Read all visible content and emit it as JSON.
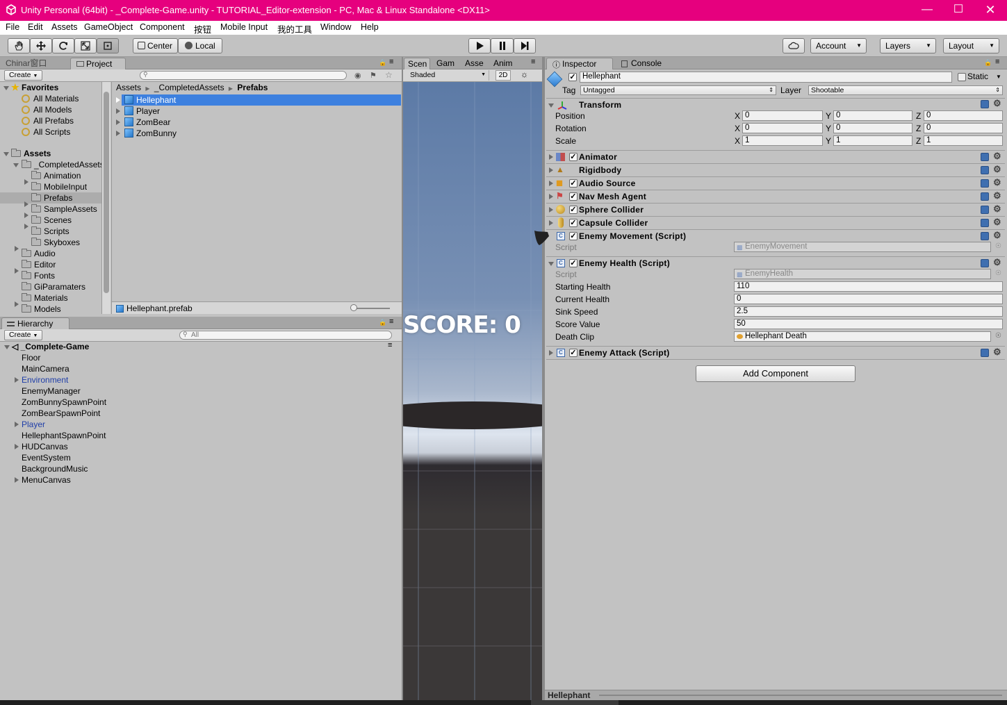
{
  "title_bar": {
    "text": "Unity Personal (64bit) - _Complete-Game.unity - TUTORIAL_Editor-extension - PC, Mac & Linux Standalone <DX11>",
    "controls": [
      "minimize",
      "maximize",
      "close"
    ]
  },
  "menu": [
    "File",
    "Edit",
    "Assets",
    "GameObject",
    "Component",
    "按钮",
    "Mobile Input",
    "我的工具",
    "Window",
    "Help"
  ],
  "toolbar": {
    "pivot": "Center",
    "space": "Local",
    "account": "Account",
    "layers": "Layers",
    "layout": "Layout"
  },
  "project_panel": {
    "tabs": [
      "Chinar窗口",
      "Project"
    ],
    "create": "Create",
    "favorites_title": "Favorites",
    "favorites": [
      "All Materials",
      "All Models",
      "All Prefabs",
      "All Scripts"
    ],
    "assets_title": "Assets",
    "tree": [
      "_CompletedAssets",
      "Animation",
      "MobileInput",
      "Prefabs",
      "SampleAssets",
      "Scenes",
      "Scripts",
      "Skyboxes",
      "Audio",
      "Editor",
      "Fonts",
      "GiParamaters",
      "Materials",
      "Models"
    ],
    "breadcrumb": [
      "Assets",
      "_CompletedAssets",
      "Prefabs"
    ],
    "files": [
      "Hellephant",
      "Player",
      "ZomBear",
      "ZomBunny"
    ],
    "selected_file": "Hellephant.prefab"
  },
  "hierarchy_panel": {
    "tab": "Hierarchy",
    "create": "Create",
    "search_placeholder": "All",
    "scene": "_Complete-Game",
    "items": [
      "Floor",
      "MainCamera",
      "Environment",
      "EnemyManager",
      "ZomBunnySpawnPoint",
      "ZomBearSpawnPoint",
      "Player",
      "HellephantSpawnPoint",
      "HUDCanvas",
      "EventSystem",
      "BackgroundMusic",
      "MenuCanvas"
    ]
  },
  "scene_panel": {
    "tabs": [
      "Scen",
      "Gam",
      "Asse",
      "Anim"
    ],
    "shading": "Shaded",
    "mode_2d": "2D",
    "score_text": "SCORE: 0"
  },
  "inspector": {
    "tabs": [
      "Inspector",
      "Console"
    ],
    "object_name": "Hellephant",
    "static_label": "Static",
    "tag_label": "Tag",
    "tag_value": "Untagged",
    "layer_label": "Layer",
    "layer_value": "Shootable",
    "transform": {
      "title": "Transform",
      "position_label": "Position",
      "rotation_label": "Rotation",
      "scale_label": "Scale",
      "position": [
        "0",
        "0",
        "0"
      ],
      "rotation": [
        "0",
        "0",
        "0"
      ],
      "scale": [
        "1",
        "1",
        "1"
      ],
      "axes": [
        "X",
        "Y",
        "Z"
      ]
    },
    "components": [
      "Animator",
      "Rigidbody",
      "Audio Source",
      "Nav Mesh Agent",
      "Sphere Collider",
      "Capsule Collider"
    ],
    "enemy_movement": {
      "title": "Enemy Movement (Script)",
      "script_label": "Script",
      "script_value": "EnemyMovement"
    },
    "enemy_health": {
      "title": "Enemy Health (Script)",
      "script_label": "Script",
      "script_value": "EnemyHealth",
      "starting_health_label": "Starting Health",
      "starting_health": "110",
      "current_health_label": "Current Health",
      "current_health": "0",
      "sink_speed_label": "Sink Speed",
      "sink_speed": "2.5",
      "score_value_label": "Score Value",
      "score_value": "50",
      "death_clip_label": "Death Clip",
      "death_clip": "Hellephant Death"
    },
    "enemy_attack": {
      "title": "Enemy Attack (Script)"
    },
    "add_component": "Add Component",
    "footer": "Hellephant"
  }
}
